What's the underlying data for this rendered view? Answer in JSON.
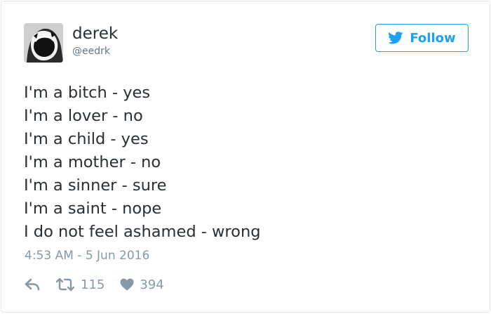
{
  "user": {
    "display_name": "derek",
    "handle": "@eedrk",
    "avatar_icon": "avatar-screaming-face"
  },
  "follow_button": {
    "label": "Follow",
    "icon": "twitter-bird-icon",
    "color": "#1da1f2"
  },
  "tweet": {
    "lines": [
      "I'm a bitch - yes",
      "I'm a lover - no",
      "I'm a child - yes",
      "I'm a mother - no",
      "I'm a sinner - sure",
      "I'm a saint - nope",
      "I do not feel ashamed - wrong"
    ],
    "timestamp": "4:53 AM - 5 Jun 2016"
  },
  "actions": {
    "reply_icon": "reply-icon",
    "retweet_icon": "retweet-icon",
    "retweet_count": "115",
    "like_icon": "heart-icon",
    "like_count": "394",
    "color": "#8899a6"
  }
}
